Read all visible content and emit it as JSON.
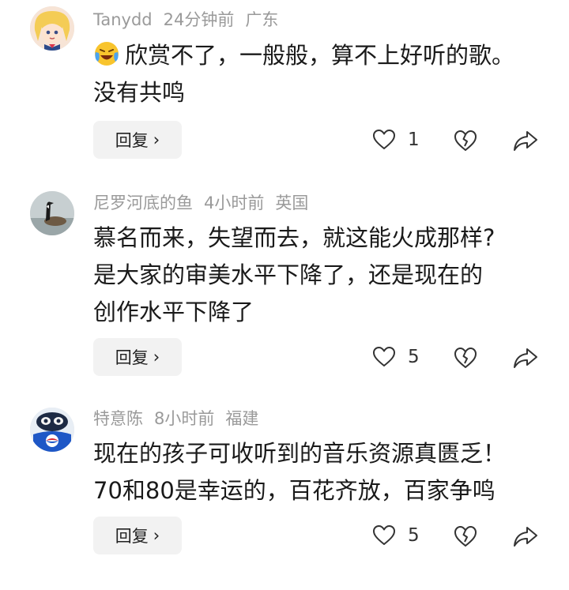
{
  "comments": [
    {
      "username": "Tanydd",
      "time": "24分钟前",
      "location": "广东",
      "avatar_icon": "anime-girl-avatar",
      "emoji_icon": "laughing-crying-emoji",
      "text_lines": [
        "欣赏不了，一般般，算不上好听的歌。",
        "没有共鸣"
      ],
      "reply_label": "回复",
      "like_count": "1"
    },
    {
      "username": "尼罗河底的鱼",
      "time": "4小时前",
      "location": "英国",
      "avatar_icon": "goose-avatar",
      "text_lines": [
        "慕名而来，失望而去，就这能火成那样?",
        "是大家的审美水平下降了，还是现在的",
        "创作水平下降了"
      ],
      "reply_label": "回复",
      "like_count": "5"
    },
    {
      "username": "特意陈",
      "time": "8小时前",
      "location": "福建",
      "avatar_icon": "pepsi-character-avatar",
      "text_lines": [
        "现在的孩子可收听到的音乐资源真匮乏！",
        "70和80是幸运的，百花齐放，百家争鸣"
      ],
      "reply_label": "回复",
      "like_count": "5"
    }
  ],
  "icons": {
    "like": "heart-outline-icon",
    "dislike": "broken-heart-icon",
    "share": "share-arrow-icon",
    "reply_chevron": "chevron-right-icon"
  }
}
